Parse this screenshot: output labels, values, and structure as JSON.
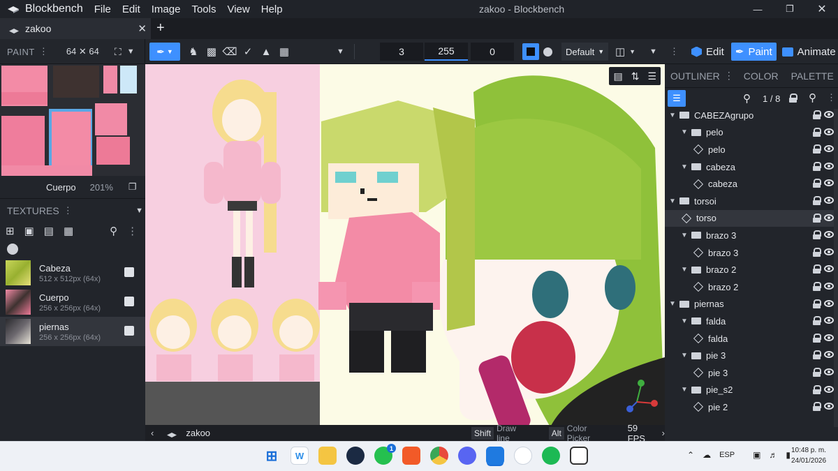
{
  "window": {
    "title": "zakoo - Blockbench",
    "app_name": "Blockbench"
  },
  "menu": [
    "File",
    "Edit",
    "Image",
    "Tools",
    "View",
    "Help"
  ],
  "tabs": [
    {
      "label": "zakoo"
    }
  ],
  "paint_panel": {
    "label": "PAINT",
    "size": "64 ✕ 64"
  },
  "toolbar": {
    "size_value": "3",
    "opacity_value": "255",
    "softness_value": "0",
    "blend_mode": "Default"
  },
  "modes": {
    "edit": "Edit",
    "paint": "Paint",
    "animate": "Animate"
  },
  "uv": {
    "texture_name": "Cuerpo",
    "zoom": "201%"
  },
  "textures": {
    "header": "TEXTURES",
    "items": [
      {
        "name": "Cabeza",
        "size": "512 x 512px (64x)"
      },
      {
        "name": "Cuerpo",
        "size": "256 x 256px (64x)"
      },
      {
        "name": "piernas",
        "size": "256 x 256px (64x)"
      }
    ]
  },
  "panel_tabs": [
    "OUTLINER",
    "COLOR",
    "PALETTE"
  ],
  "outliner": {
    "count": "1 / 8",
    "tree": [
      {
        "label": "CABEZAgrupo",
        "type": "group",
        "depth": 0
      },
      {
        "label": "pelo",
        "type": "group",
        "depth": 1
      },
      {
        "label": "pelo",
        "type": "cube",
        "depth": 2
      },
      {
        "label": "cabeza",
        "type": "group",
        "depth": 1
      },
      {
        "label": "cabeza",
        "type": "cube",
        "depth": 2
      },
      {
        "label": "torsoi",
        "type": "group",
        "depth": 0
      },
      {
        "label": "torso",
        "type": "cube",
        "depth": 1,
        "selected": true
      },
      {
        "label": "brazo 3",
        "type": "group",
        "depth": 1
      },
      {
        "label": "brazo 3",
        "type": "cube",
        "depth": 2
      },
      {
        "label": "brazo 2",
        "type": "group",
        "depth": 1
      },
      {
        "label": "brazo 2",
        "type": "cube",
        "depth": 2
      },
      {
        "label": "piernas",
        "type": "group",
        "depth": 0
      },
      {
        "label": "falda",
        "type": "group",
        "depth": 1
      },
      {
        "label": "falda",
        "type": "cube",
        "depth": 2
      },
      {
        "label": "pie 3",
        "type": "group",
        "depth": 1
      },
      {
        "label": "pie 3",
        "type": "cube",
        "depth": 2
      },
      {
        "label": "pie_s2",
        "type": "group",
        "depth": 1
      },
      {
        "label": "pie 2",
        "type": "cube",
        "depth": 2
      }
    ]
  },
  "status": {
    "project": "zakoo",
    "key1": "Shift",
    "hint1": "Draw line",
    "key2": "Alt",
    "hint2": "Color Picker",
    "fps": "59 FPS"
  },
  "taskbar": {
    "lang": "ESP",
    "time": "10:48 p. m.",
    "date": "24/01/2026",
    "whatsapp_badge": "1"
  },
  "colors": {
    "accent": "#3e90ff",
    "panel": "#22252b"
  }
}
